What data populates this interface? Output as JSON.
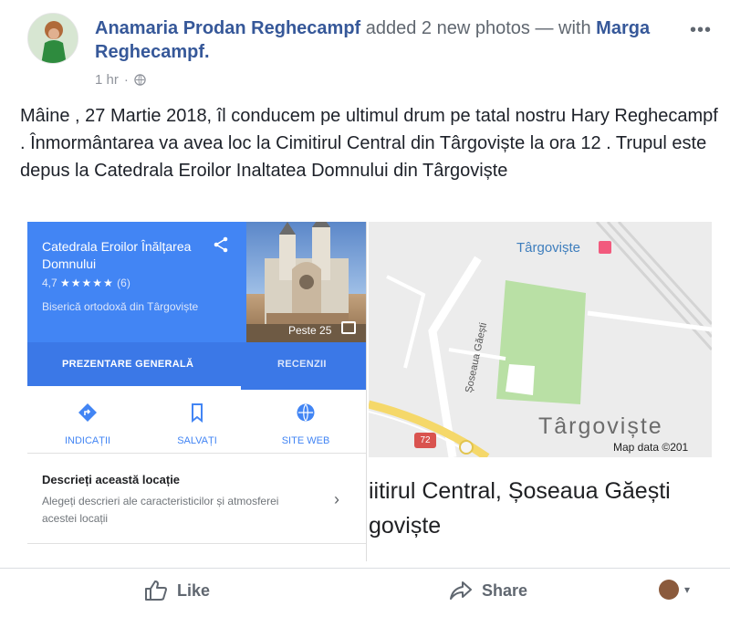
{
  "post": {
    "author": "Anamaria Prodan Reghecampf",
    "action_text": " added 2 new photos — with ",
    "tagged": "Marga Reghecampf.",
    "time": "1 hr",
    "separator": "·",
    "text": "Mâine , 27 Martie 2018, îl conducem pe ultimul drum pe tatal nostru Hary Reghecampf . Înmormântarea va avea loc la Cimitirul Central din Târgoviște la ora 12 . Trupul este depus la Catedrala Eroilor Inaltatea Domnului din Târgoviște",
    "more_label": "•••"
  },
  "photo_left": {
    "place_name": "Catedrala Eroilor Înălțarea Domnului",
    "rating_value": "4,7",
    "stars": "★★★★★",
    "review_count": "(6)",
    "place_type": "Biserică ortodoxă din Târgoviște",
    "photos_count": "Peste 25",
    "tab_overview": "PREZENTARE GENERALĂ",
    "tab_reviews": "RECENZII",
    "action_directions": "INDICAȚII",
    "action_save": "SALVAȚI",
    "action_website": "SITE WEB",
    "describe_title": "Descrieți această locație",
    "describe_text": "Alegeți descrieri ale caracteristicilor și atmosferei acestei locații",
    "chevron": "›"
  },
  "photo_right": {
    "map_title": "Târgoviște",
    "map_city": "Târgoviște",
    "street": "Șoseaua Găești",
    "shield": "72",
    "attribution": "Map data ©201",
    "caption_line1": "iitirul Central, Șoseaua Găești",
    "caption_line2": "goviște"
  },
  "footer": {
    "like_label": "Like",
    "share_label": "Share",
    "caret": "▾"
  },
  "colors": {
    "link_blue": "#365899",
    "maps_blue": "#4285f4",
    "text": "#1d2129",
    "muted": "#90949c"
  }
}
